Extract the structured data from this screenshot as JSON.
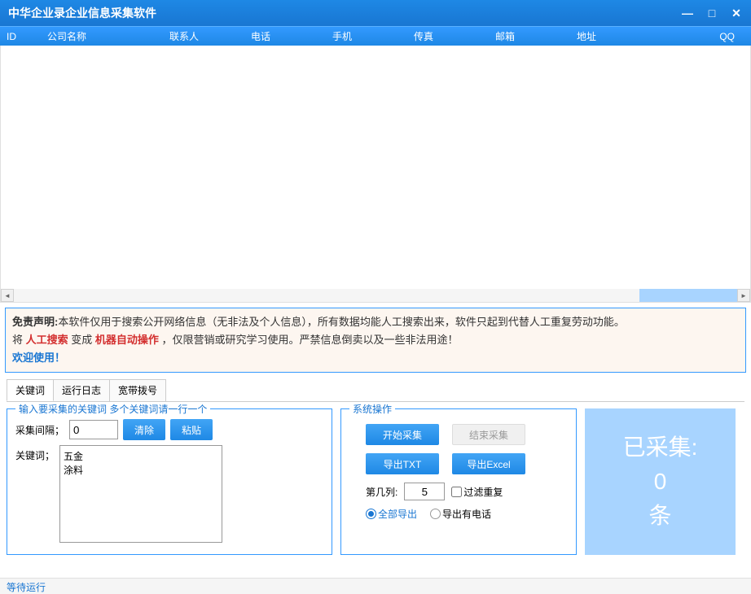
{
  "window": {
    "title": "中华企业录企业信息采集软件"
  },
  "columns": {
    "id": "ID",
    "company": "公司名称",
    "contact": "联系人",
    "phone": "电话",
    "mobile": "手机",
    "fax": "传真",
    "email": "邮箱",
    "addr": "地址",
    "qq": "QQ"
  },
  "disclaimer": {
    "l1a": "免责声明:",
    "l1b": "本软件仅用于搜索公开网络信息（无非法及个人信息），所有数据均能人工搜索出来，软件只起到代替人工重复劳动功能。",
    "l2a": "将 ",
    "l2r1": "人工搜索",
    "l2b": " 变成 ",
    "l2r2": "机器自动操作",
    "l2c": " ，仅限营销或研究学习使用。严禁信息倒卖以及一些非法用途！",
    "l3": "欢迎使用！"
  },
  "tabs": {
    "kw": "关键词",
    "log": "运行日志",
    "dial": "宽带拨号"
  },
  "kw": {
    "group_title": "输入要采集的关键词 多个关键词请一行一个",
    "interval_label": "采集间隔；",
    "interval_value": "0",
    "clear": "清除",
    "paste": "粘贴",
    "kw_label": "关键词；",
    "kw_value": "五金\n涂料"
  },
  "sys": {
    "group_title": "系统操作",
    "start": "开始采集",
    "stop": "结束采集",
    "export_txt": "导出TXT",
    "export_excel": "导出Excel",
    "col_label": "第几列:",
    "col_value": "5",
    "filter_dup": "过滤重复",
    "export_all": "全部导出",
    "export_phone": "导出有电话"
  },
  "counter": {
    "l1": "已采集:",
    "l2": "0",
    "l3": "条"
  },
  "status": "等待运行"
}
